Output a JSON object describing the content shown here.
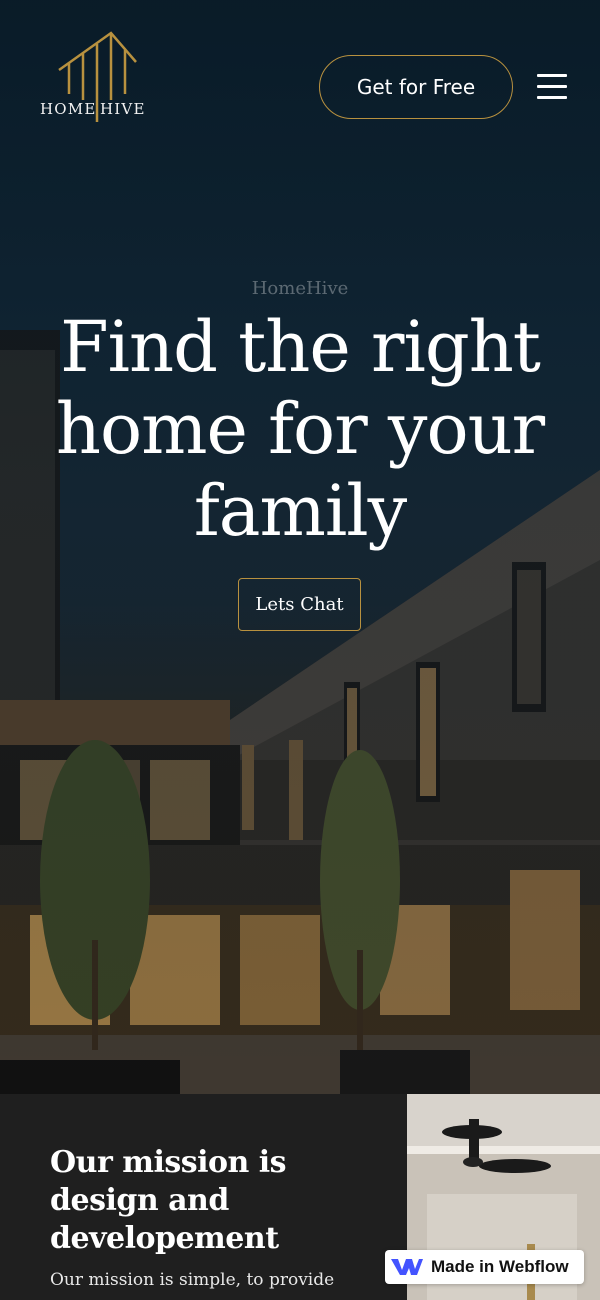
{
  "brand": {
    "home": "HOME",
    "hive": "HIVE",
    "accent_color": "#b8913f"
  },
  "header": {
    "cta_label": "Get for Free",
    "menu_icon": "hamburger-menu-icon"
  },
  "hero": {
    "eyebrow": "HomeHive",
    "headline": "Find the right home for your family",
    "chat_label": "Lets Chat"
  },
  "mission": {
    "title": "Our mission is design and developement",
    "text": "Our mission is simple, to provide"
  },
  "badge": {
    "label": "Made in Webflow",
    "icon": "webflow-logo-icon"
  }
}
